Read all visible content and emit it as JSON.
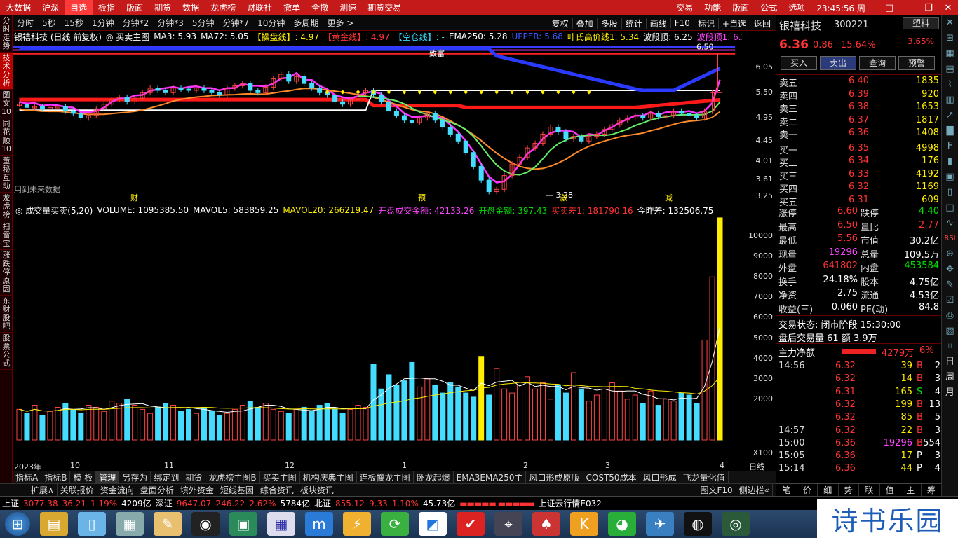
{
  "topbar": {
    "menu": [
      "大数据",
      "沪深",
      "自选",
      "板指",
      "版面",
      "期货",
      "数据",
      "龙虎榜",
      "财联社",
      "撤单",
      "全撤",
      "测速",
      "期货交易"
    ],
    "active": "自选",
    "right_menu": [
      "交易",
      "功能",
      "版面",
      "公式",
      "选项"
    ],
    "clock": "23:45:56 周一"
  },
  "leftbar": [
    "分时走势",
    "技术分析",
    "图文10",
    "同花顺10",
    "董秘互动",
    "龙虎榜",
    "扫雷宝",
    "涨跌停原因",
    "东财股吧",
    "股票公式"
  ],
  "periods": [
    "分时",
    "5秒",
    "15秒",
    "1分钟",
    "分钟*2",
    "分钟*3",
    "5分钟",
    "分钟*7",
    "10分钟",
    "多周期",
    "更多 >"
  ],
  "toolbar_right": [
    "复权",
    "叠加",
    "多股",
    "统计",
    "画线",
    "F10",
    "标记",
    "+自选",
    "返回"
  ],
  "chart_info": {
    "title": "银禧科技 (日线 前复权)",
    "formula": "◎ 买卖主图",
    "ma3": "MA3: 5.93",
    "ma72": "MA72: 5.05",
    "caopan": "【操盘线】: 4.97",
    "huangjin": "【黄金线】: 4.97",
    "kongcang": "【空仓线】: -",
    "ema250": "EMA250: 5.28",
    "upper": "UPPER: 5.68",
    "yeshi": "叶氏高价线1: 5.34",
    "boduan": "波段顶: 6.25",
    "boduan1": "波段顶1: 6.25",
    "more": "波"
  },
  "price_axis": [
    "6.05",
    "5.50",
    "4.95",
    "4.45",
    "4.01",
    "3.61",
    "3.25"
  ],
  "price_labels": {
    "high": "6.50",
    "low": "3.28",
    "jiyun": "致富",
    "future": "用到未来数据"
  },
  "markers": [
    "财",
    "预",
    "激",
    "减"
  ],
  "vol_info": {
    "title": "◎ 成交量买卖(5,20)",
    "volume": "VOLUME: 1095385.50",
    "mavol5": "MAVOL5: 583859.25",
    "mavol20": "MAVOL20: 266219.47",
    "kaipan_amt": "开盘成交金额: 42133.26",
    "kaipan_jin": "开盘金额: 397.43",
    "maimai": "买卖差1: 181790.16",
    "jinzha": "今昨差: 132506.75"
  },
  "vol_axis": [
    "10000",
    "9000",
    "8000",
    "7000",
    "6000",
    "5000",
    "4000",
    "3000",
    "2000"
  ],
  "vol_unit": "X100",
  "date_axis": [
    "2023年",
    "10",
    "11",
    "12",
    "1",
    "2",
    "3",
    "4"
  ],
  "date_axis_right": "日线",
  "tabs": [
    "指标A",
    "指标B",
    "模 板",
    "管理",
    "另存为",
    "绑定到",
    "期货",
    "龙虎榜主图B",
    "买卖主图",
    "机构庆典主图",
    "连板擒龙主图",
    "卧龙起爆",
    "EMA3EMA250主",
    "风口形成原版",
    "COST50成本",
    "风口形成",
    "飞龙量化值"
  ],
  "subtabs": [
    "扩展∧",
    "关联报价",
    "资金流向",
    "盘面分析",
    "填外资金",
    "短线基因",
    "综合资讯",
    "板块资讯"
  ],
  "subtabs_right": [
    "图文F10",
    "侧边栏«"
  ],
  "bottom_right_tabs": [
    "笔",
    "价",
    "细",
    "势",
    "联",
    "值",
    "主",
    "筹"
  ],
  "stock": {
    "name": "银禧科技",
    "code": "300221",
    "tag": "塑料",
    "tag_pct": "3.65%",
    "price": "6.36",
    "change": "0.86",
    "pct": "15.64%",
    "buttons": [
      "买入",
      "卖出",
      "查询",
      "预警"
    ]
  },
  "asks": [
    {
      "label": "卖五",
      "price": "6.40",
      "vol": "1835"
    },
    {
      "label": "卖四",
      "price": "6.39",
      "vol": "920"
    },
    {
      "label": "卖三",
      "price": "6.38",
      "vol": "1653"
    },
    {
      "label": "卖二",
      "price": "6.37",
      "vol": "1817"
    },
    {
      "label": "卖一",
      "price": "6.36",
      "vol": "1408"
    }
  ],
  "bids": [
    {
      "label": "买一",
      "price": "6.35",
      "vol": "4998"
    },
    {
      "label": "买二",
      "price": "6.34",
      "vol": "176"
    },
    {
      "label": "买三",
      "price": "6.33",
      "vol": "4192"
    },
    {
      "label": "买四",
      "price": "6.32",
      "vol": "1169"
    },
    {
      "label": "买五",
      "price": "6.31",
      "vol": "609"
    }
  ],
  "stats": [
    {
      "l1": "涨停",
      "v1": "6.60",
      "c1": "red",
      "l2": "跌停",
      "v2": "4.40",
      "c2": "green"
    },
    {
      "l1": "最高",
      "v1": "6.50",
      "c1": "red",
      "l2": "量比",
      "v2": "2.77",
      "c2": "red"
    },
    {
      "l1": "最低",
      "v1": "5.56",
      "c1": "red",
      "l2": "市值",
      "v2": "30.2亿",
      "c2": "white"
    },
    {
      "l1": "现量",
      "v1": "19296",
      "c1": "magenta",
      "l2": "总量",
      "v2": "109.5万",
      "c2": "white"
    },
    {
      "l1": "外盘",
      "v1": "641802",
      "c1": "red",
      "l2": "内盘",
      "v2": "453584",
      "c2": "green"
    },
    {
      "l1": "换手",
      "v1": "24.18%",
      "c1": "white",
      "l2": "股本",
      "v2": "4.75亿",
      "c2": "white"
    },
    {
      "l1": "净资",
      "v1": "2.75",
      "c1": "white",
      "l2": "流通",
      "v2": "4.53亿",
      "c2": "white"
    },
    {
      "l1": "收益(三)",
      "v1": "0.060",
      "c1": "white",
      "l2": "PE(动)",
      "v2": "84.8",
      "c2": "white"
    }
  ],
  "trade_status": "交易状态: 闭市阶段 15:30:00",
  "after_hours": "盘后交易量 61 额 3.9万",
  "main_flow": {
    "label": "主力净额",
    "value": "4279万",
    "pct": "6%"
  },
  "ticks": [
    {
      "t": "14:56",
      "p": "6.32",
      "v": "39",
      "s": "B",
      "n": "2"
    },
    {
      "t": "",
      "p": "6.32",
      "v": "14",
      "s": "B",
      "n": "3"
    },
    {
      "t": "",
      "p": "6.31",
      "v": "165",
      "s": "S",
      "n": "4"
    },
    {
      "t": "",
      "p": "6.32",
      "v": "199",
      "s": "B",
      "n": "13"
    },
    {
      "t": "",
      "p": "6.32",
      "v": "85",
      "s": "B",
      "n": "5"
    },
    {
      "t": "14:57",
      "p": "6.32",
      "v": "22",
      "s": "B",
      "n": "3"
    },
    {
      "t": "15:00",
      "p": "6.36",
      "v": "19296",
      "s": "B",
      "n": "554"
    },
    {
      "t": "15:05",
      "p": "6.36",
      "v": "17",
      "s": "P",
      "n": "3"
    },
    {
      "t": "15:14",
      "p": "6.36",
      "v": "44",
      "s": "P",
      "n": "4"
    }
  ],
  "indexbar": {
    "sh": "上证",
    "sh_v": "3077.38",
    "sh_c": "36.21",
    "sh_p": "1.19%",
    "sh_a": "4209亿",
    "sz": "深证",
    "sz_v": "9647.07",
    "sz_c": "246.22",
    "sz_p": "2.62%",
    "sz_a": "5784亿",
    "bz": "北证",
    "bz_v": "855.12",
    "bz_c": "9.33",
    "bz_p": "1.10%",
    "bz_a": "45.73亿",
    "cloud": "上证云行情E032"
  },
  "watermark": "诗书乐园",
  "chart_data": {
    "type": "bar",
    "title": "成交量买卖(5,20)",
    "xlabel": "",
    "ylabel": "",
    "ylim": [
      0,
      11000
    ],
    "price_ylim": [
      3.1,
      6.6
    ],
    "price_series": [
      5.25,
      5.18,
      5.2,
      5.15,
      5.18,
      5.2,
      5.1,
      5.05,
      4.95,
      5.0,
      5.15,
      5.25,
      5.35,
      5.4,
      5.3,
      5.38,
      5.5,
      5.6,
      5.55,
      5.5,
      5.6,
      5.58,
      5.55,
      5.6,
      5.55,
      5.5,
      5.45,
      5.6,
      5.65,
      5.7,
      5.55,
      5.5,
      5.62,
      5.8,
      5.9,
      5.75,
      5.85,
      5.7,
      5.6,
      5.5,
      5.45,
      5.3,
      5.25,
      5.35,
      5.5,
      5.55,
      5.45,
      5.3,
      5.1,
      5.0,
      4.9,
      4.85,
      4.95,
      5.05,
      4.9,
      4.75,
      4.6,
      4.45,
      4.2,
      3.9,
      3.6,
      3.35,
      3.4,
      3.7,
      3.95,
      4.1,
      4.3,
      4.4,
      4.6,
      4.75,
      4.65,
      4.5,
      4.55,
      4.45,
      4.55,
      4.6,
      4.7,
      4.8,
      4.9,
      4.95,
      5.0,
      4.95,
      5.05,
      4.98,
      5.0,
      5.1,
      5.05,
      5.0,
      4.95,
      5.1,
      5.5,
      6.36
    ],
    "volume_series": [
      1500,
      1300,
      1700,
      1200,
      1400,
      1600,
      1800,
      1500,
      1300,
      1700,
      1600,
      1400,
      1900,
      1800,
      2000,
      1700,
      1500,
      1300,
      1600,
      1800,
      1700,
      1400,
      1500,
      1300,
      1600,
      1400,
      1200,
      1300,
      1500,
      1700,
      1900,
      1600,
      1800,
      1500,
      1400,
      1300,
      1500,
      1600,
      1400,
      1700,
      1800,
      1500,
      1300,
      1500,
      1700,
      1600,
      3700,
      2500,
      3200,
      2700,
      2900,
      3800,
      2600,
      3000,
      2700,
      2300,
      2800,
      2600,
      2300,
      2100,
      4100,
      2200,
      3500,
      2500,
      2300,
      2700,
      3100,
      2500,
      2800,
      2000,
      2700,
      2300,
      3300,
      2500,
      1900,
      2200,
      2600,
      2800,
      2400,
      2000,
      2200,
      1800,
      2400,
      1700,
      2000,
      1900,
      2300,
      2200,
      1800,
      4900,
      8000,
      10900
    ]
  }
}
